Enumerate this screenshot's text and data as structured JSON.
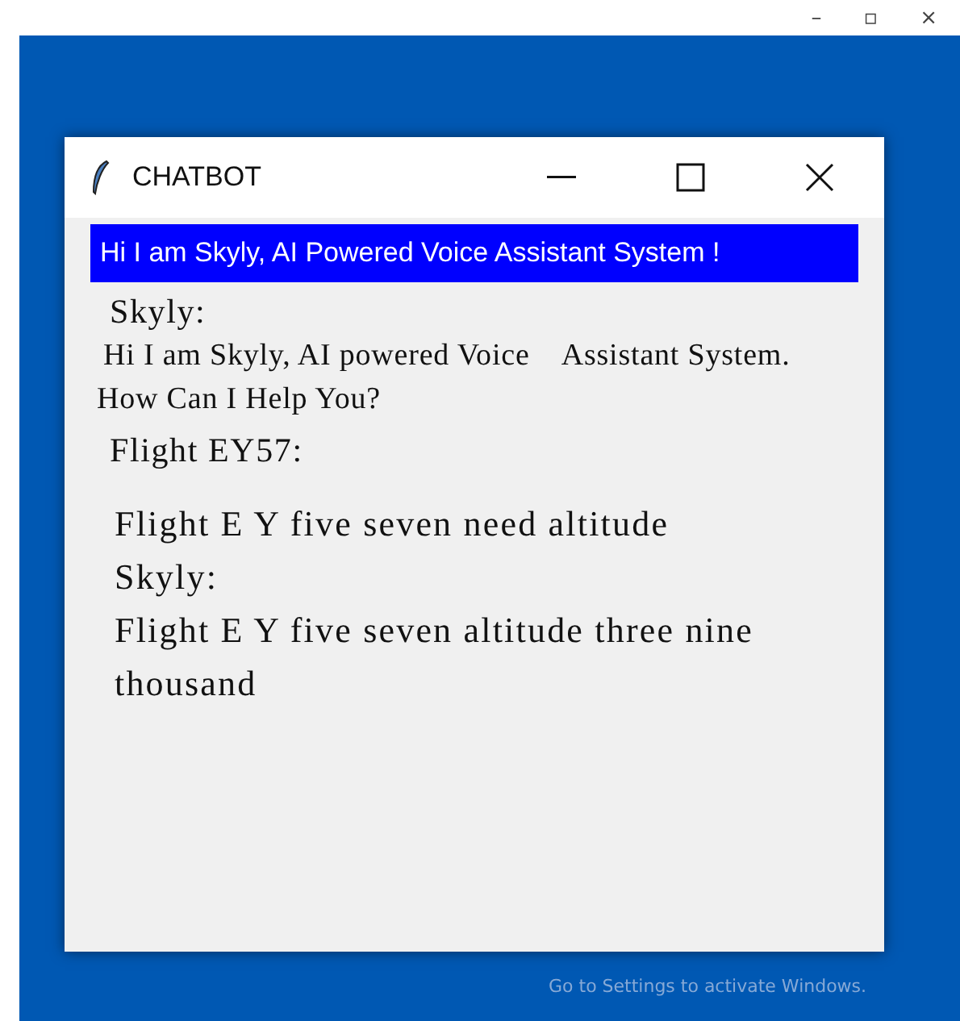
{
  "screen_controls": [
    "–",
    "▫",
    "×"
  ],
  "window": {
    "title": "CHATBOT",
    "controls": [
      {
        "kind": "minimize"
      },
      {
        "kind": "maximize"
      },
      {
        "kind": "close"
      }
    ]
  },
  "banner": "Hi I am Skyly, AI Powered Voice Assistant System !",
  "messages": [
    {
      "kind": "sender",
      "text": "Skyly:"
    },
    {
      "kind": "reply",
      "text": "Hi I am Skyly, AI powered Voice    Assistant System. How Can I Help You?"
    },
    {
      "kind": "sender",
      "text": "Flight EY57:"
    },
    {
      "kind": "speech",
      "text": "Flight E Y five seven need altitude"
    },
    {
      "kind": "speech",
      "text": "Skyly:"
    },
    {
      "kind": "speech",
      "text": "Flight E Y five seven altitude three nine thousand"
    }
  ],
  "desktop_notice": "Go to Settings to activate Windows."
}
